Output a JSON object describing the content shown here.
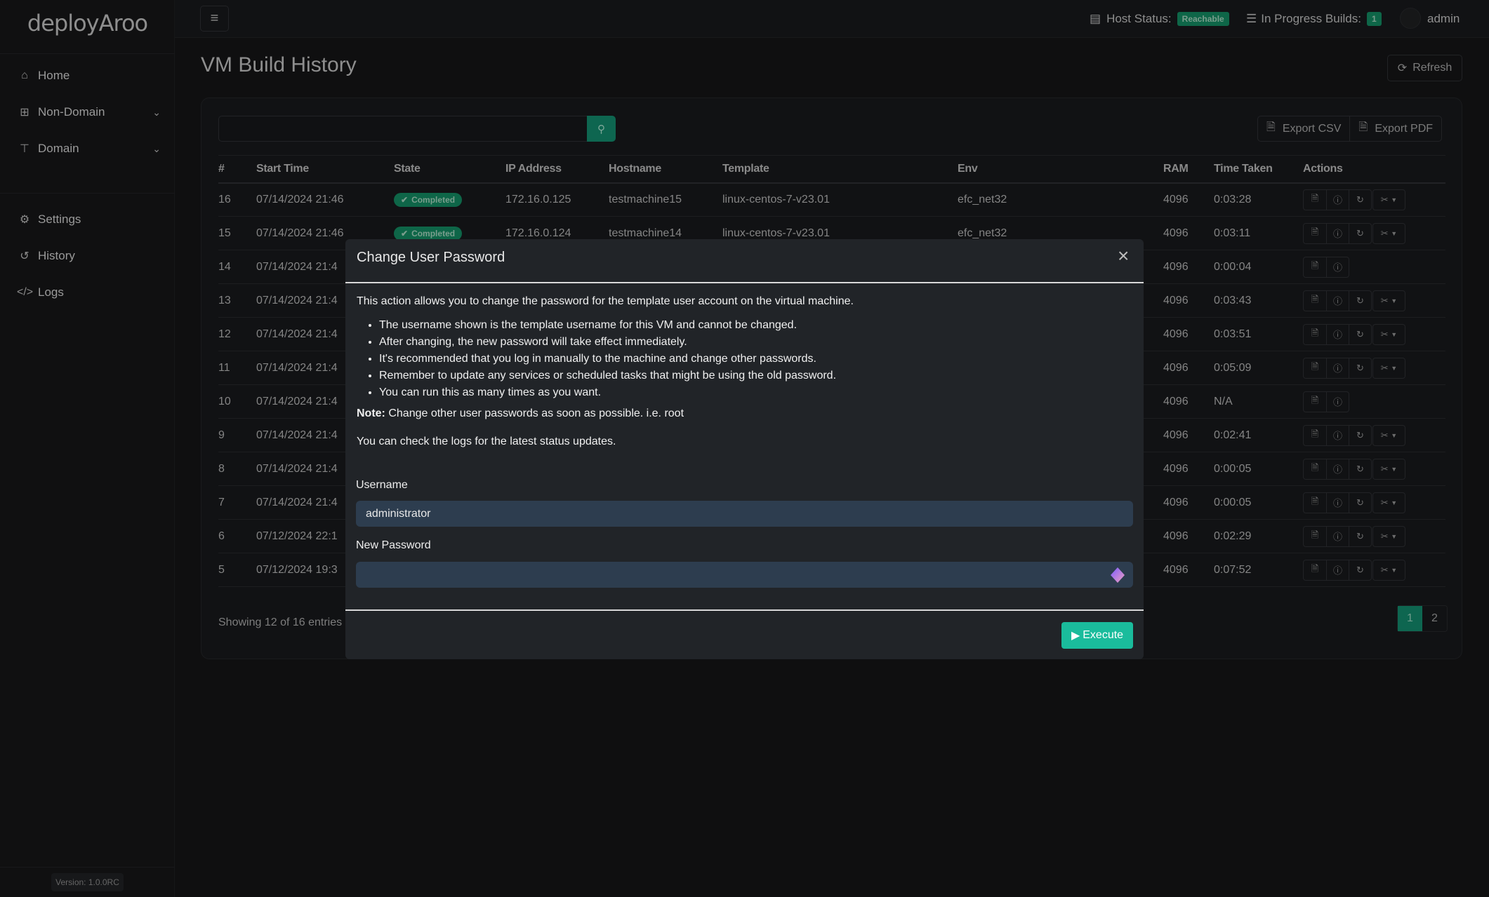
{
  "app": {
    "logo": "deployAroo",
    "version": "Version: 1.0.0RC"
  },
  "sidebar": {
    "items": [
      {
        "label": "Home",
        "icon": "home-icon"
      },
      {
        "label": "Non-Domain",
        "icon": "network-icon"
      },
      {
        "label": "Domain",
        "icon": "sitemap-icon"
      },
      {
        "label": "Settings",
        "icon": "gear-icon"
      },
      {
        "label": "History",
        "icon": "history-icon"
      },
      {
        "label": "Logs",
        "icon": "code-icon"
      }
    ]
  },
  "topbar": {
    "host_status_label": "Host Status:",
    "host_status_value": "Reachable",
    "in_progress_label": "In Progress Builds:",
    "in_progress_count": "1",
    "user": "admin"
  },
  "page": {
    "title": "VM Build History",
    "refresh_label": "Refresh"
  },
  "toolbar": {
    "search_value": "",
    "export_csv": "Export CSV",
    "export_pdf": "Export PDF"
  },
  "table": {
    "headers": [
      "#",
      "Start Time",
      "State",
      "IP Address",
      "Hostname",
      "Template",
      "Env",
      "RAM",
      "Time Taken",
      "Actions"
    ],
    "rows": [
      {
        "id": "16",
        "start": "07/14/2024 21:46",
        "state": "Completed",
        "ip": "172.16.0.125",
        "host": "testmachine15",
        "template": "linux-centos-7-v23.01",
        "env": "efc_net32",
        "ram": "4096",
        "time": "0:03:28",
        "full_actions": true
      },
      {
        "id": "15",
        "start": "07/14/2024 21:46",
        "state": "Completed",
        "ip": "172.16.0.124",
        "host": "testmachine14",
        "template": "linux-centos-7-v23.01",
        "env": "efc_net32",
        "ram": "4096",
        "time": "0:03:11",
        "full_actions": true
      },
      {
        "id": "14",
        "start": "07/14/2024 21:4",
        "ram": "4096",
        "time": "0:00:04",
        "full_actions": false
      },
      {
        "id": "13",
        "start": "07/14/2024 21:4",
        "ram": "4096",
        "time": "0:03:43",
        "full_actions": true
      },
      {
        "id": "12",
        "start": "07/14/2024 21:4",
        "ram": "4096",
        "time": "0:03:51",
        "full_actions": true
      },
      {
        "id": "11",
        "start": "07/14/2024 21:4",
        "ram": "4096",
        "time": "0:05:09",
        "full_actions": true
      },
      {
        "id": "10",
        "start": "07/14/2024 21:4",
        "ram": "4096",
        "time": "N/A",
        "full_actions": false
      },
      {
        "id": "9",
        "start": "07/14/2024 21:4",
        "ram": "4096",
        "time": "0:02:41",
        "full_actions": true
      },
      {
        "id": "8",
        "start": "07/14/2024 21:4",
        "ram": "4096",
        "time": "0:00:05",
        "full_actions": true
      },
      {
        "id": "7",
        "start": "07/14/2024 21:4",
        "ram": "4096",
        "time": "0:00:05",
        "full_actions": true
      },
      {
        "id": "6",
        "start": "07/12/2024 22:1",
        "ram": "4096",
        "time": "0:02:29",
        "full_actions": true
      },
      {
        "id": "5",
        "start": "07/12/2024 19:3",
        "ram": "4096",
        "time": "0:07:52",
        "full_actions": true
      }
    ],
    "showing": "Showing 12 of 16 entries",
    "pages": [
      "1",
      "2"
    ],
    "current_page": "1"
  },
  "modal": {
    "title": "Change User Password",
    "intro": "This action allows you to change the password for the template user account on the virtual machine.",
    "bullets": [
      "The username shown is the template username for this VM and cannot be changed.",
      "After changing, the new password will take effect immediately.",
      "It's recommended that you log in manually to the machine and change other passwords.",
      "Remember to update any services or scheduled tasks that might be using the old password.",
      "You can run this as many times as you want."
    ],
    "note_label": "Note:",
    "note_text": " Change other user passwords as soon as possible. i.e. root",
    "logs_text": "You can check the logs for the latest status updates.",
    "username_label": "Username",
    "username_value": "administrator",
    "password_label": "New Password",
    "password_value": "",
    "execute_label": "Execute"
  },
  "colors": {
    "accent": "#1abc9c",
    "badge_green": "#0e6648",
    "modal_bg": "#212428",
    "input_bg": "#2d3d4f"
  }
}
